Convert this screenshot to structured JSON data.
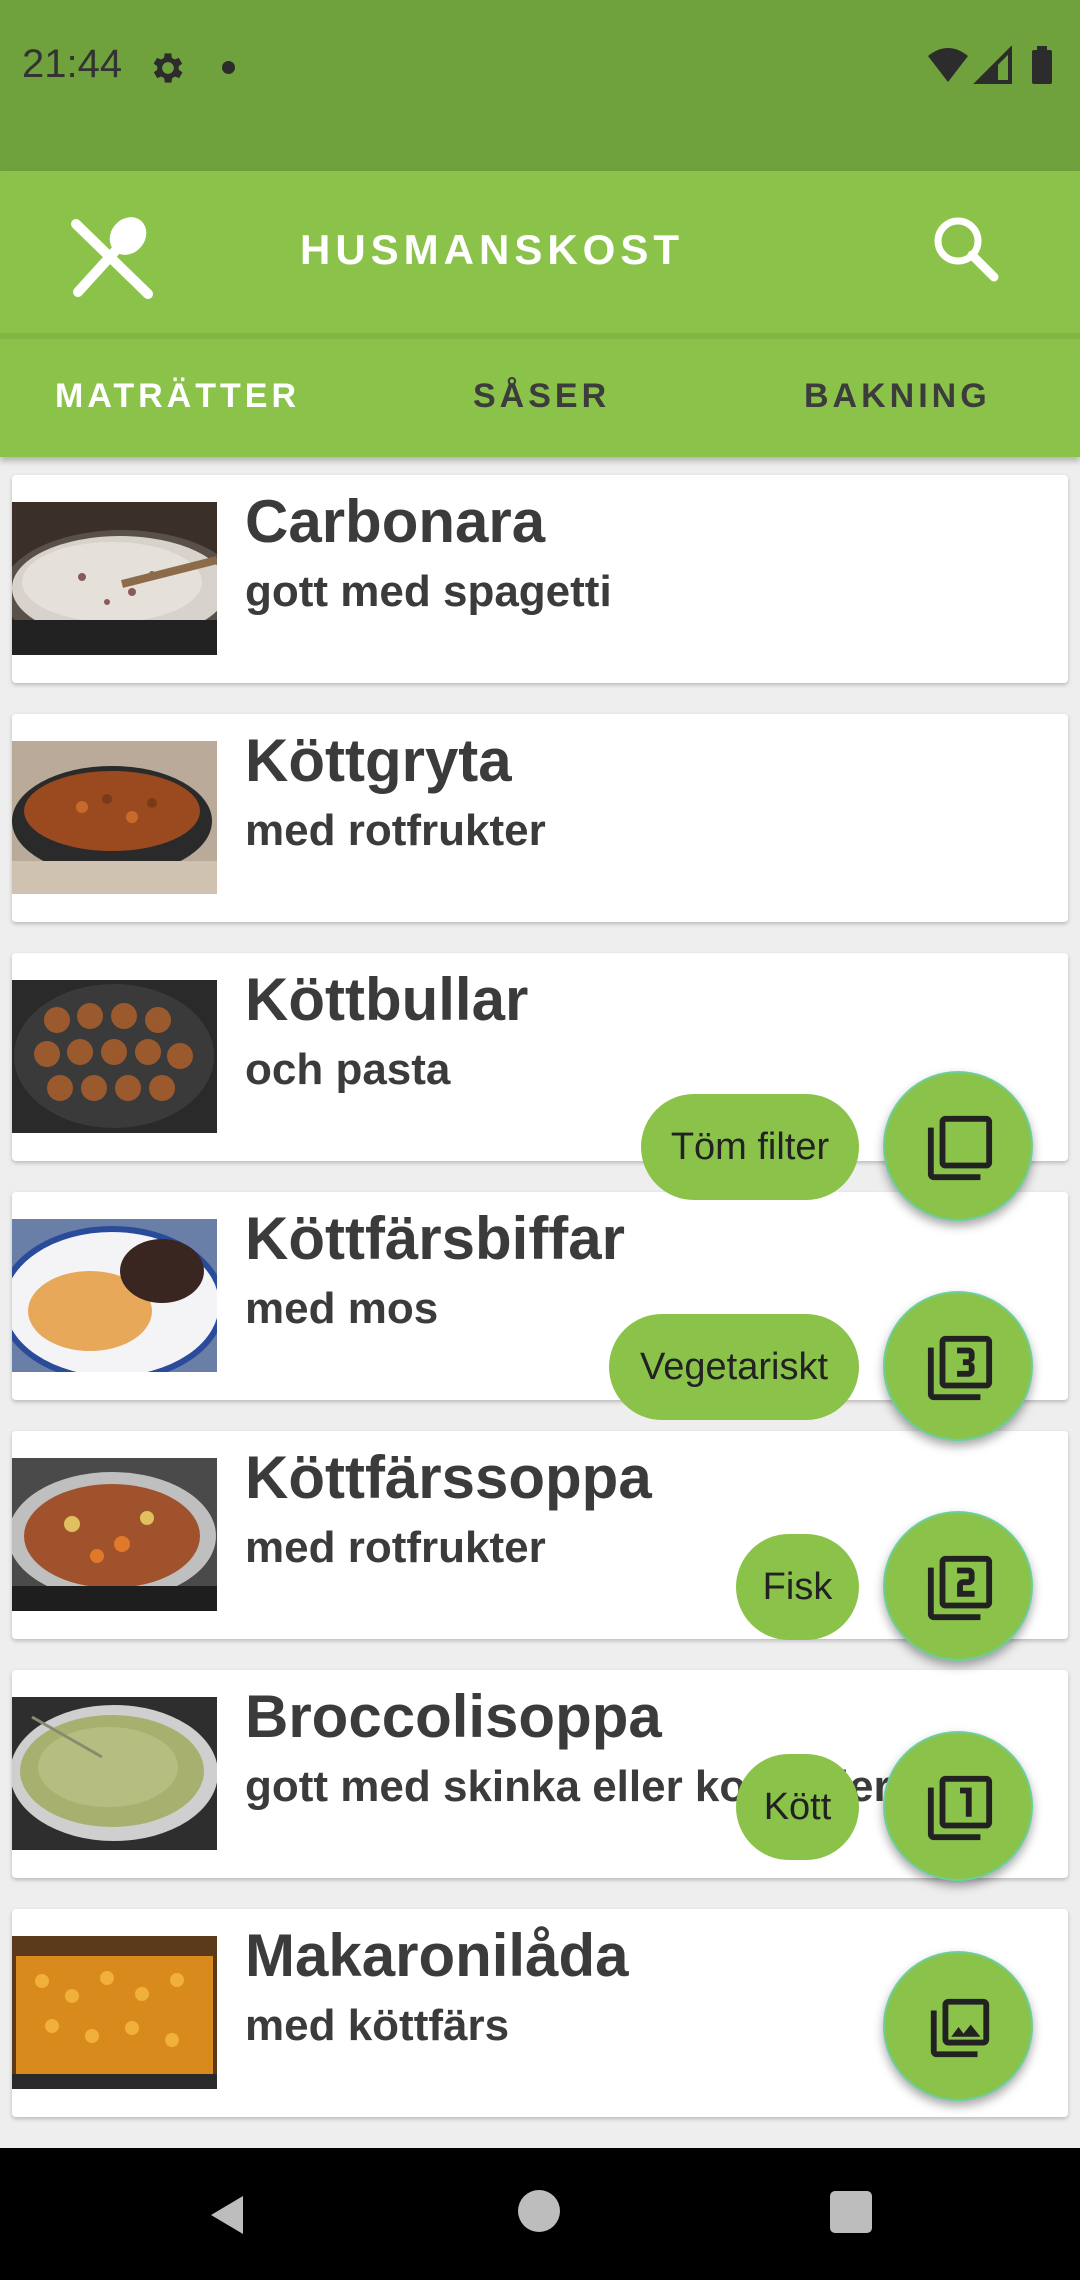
{
  "status_bar": {
    "time": "21:44"
  },
  "app_bar": {
    "title": "HUSMANSKOST"
  },
  "tabs": [
    {
      "label": "MATRÄTTER",
      "active": true
    },
    {
      "label": "SÅSER",
      "active": false
    },
    {
      "label": "BAKNING",
      "active": false
    }
  ],
  "recipes": [
    {
      "title": "Carbonara",
      "subtitle": "gott med spagetti"
    },
    {
      "title": "Köttgryta",
      "subtitle": "med rotfrukter"
    },
    {
      "title": "Köttbullar",
      "subtitle": "och pasta"
    },
    {
      "title": "Köttfärsbiffar",
      "subtitle": "med mos"
    },
    {
      "title": "Köttfärssoppa",
      "subtitle": "med rotfrukter"
    },
    {
      "title": "Broccolisoppa",
      "subtitle": "gott med skinka eller korv eller"
    },
    {
      "title": "Makaronilåda",
      "subtitle": "med köttfärs"
    }
  ],
  "fab_menu": [
    {
      "label": "Töm filter",
      "icon": "filter-none-icon"
    },
    {
      "label": "Vegetariskt",
      "icon": "filter-3-icon"
    },
    {
      "label": "Fisk",
      "icon": "filter-2-icon"
    },
    {
      "label": "Kött",
      "icon": "filter-1-icon"
    }
  ],
  "main_fab": {
    "icon": "photo-library-icon"
  },
  "colors": {
    "status_bar": "#6fa23c",
    "app_bar": "#8bc34a",
    "accent": "#8bc34a",
    "text": "#3b3b3b"
  }
}
